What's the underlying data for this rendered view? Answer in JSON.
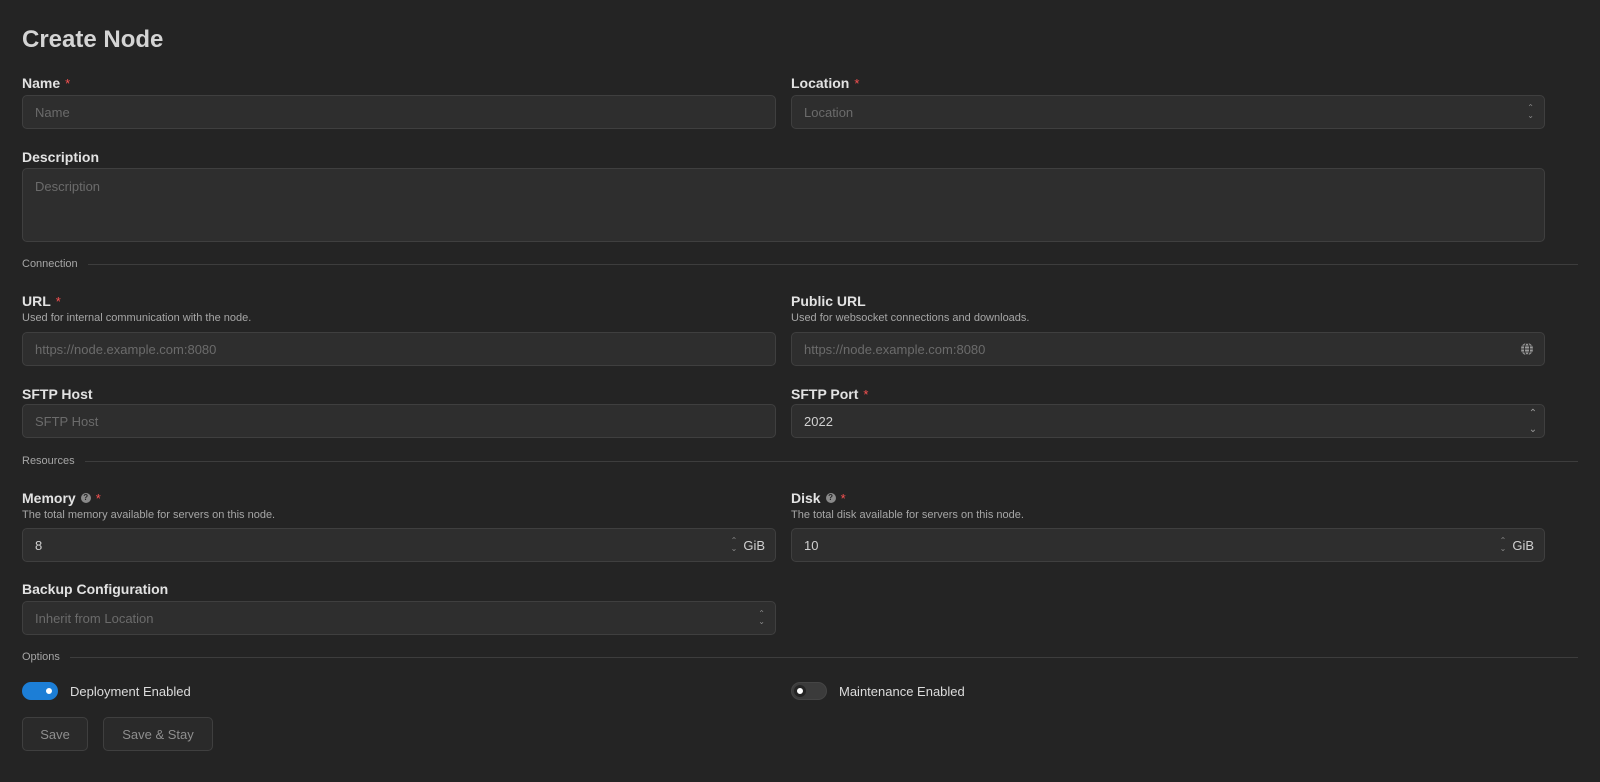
{
  "page": {
    "title": "Create Node"
  },
  "name": {
    "label": "Name",
    "required": "*",
    "placeholder": "Name"
  },
  "location": {
    "label": "Location",
    "required": "*",
    "placeholder": "Location"
  },
  "description": {
    "label": "Description",
    "placeholder": "Description"
  },
  "sections": {
    "connection": "Connection",
    "resources": "Resources",
    "options": "Options"
  },
  "url": {
    "label": "URL",
    "required": "*",
    "help": "Used for internal communication with the node.",
    "placeholder": "https://node.example.com:8080"
  },
  "public_url": {
    "label": "Public URL",
    "help": "Used for websocket connections and downloads.",
    "placeholder": "https://node.example.com:8080",
    "icon": "globe-icon"
  },
  "sftp_host": {
    "label": "SFTP Host",
    "placeholder": "SFTP Host"
  },
  "sftp_port": {
    "label": "SFTP Port",
    "required": "*",
    "value": "2022"
  },
  "memory": {
    "label": "Memory",
    "required": "*",
    "help": "The total memory available for servers on this node.",
    "value": "8",
    "unit": "GiB"
  },
  "disk": {
    "label": "Disk",
    "required": "*",
    "help": "The total disk available for servers on this node.",
    "value": "10",
    "unit": "GiB"
  },
  "backup": {
    "label": "Backup Configuration",
    "placeholder": "Inherit from Location"
  },
  "options": {
    "deployment": {
      "label": "Deployment Enabled",
      "enabled": true
    },
    "maintenance": {
      "label": "Maintenance Enabled",
      "enabled": false
    }
  },
  "actions": {
    "save": "Save",
    "save_stay": "Save & Stay"
  },
  "colors": {
    "background": "#242424",
    "accent": "#1c7ed6",
    "required": "#fa5252"
  }
}
